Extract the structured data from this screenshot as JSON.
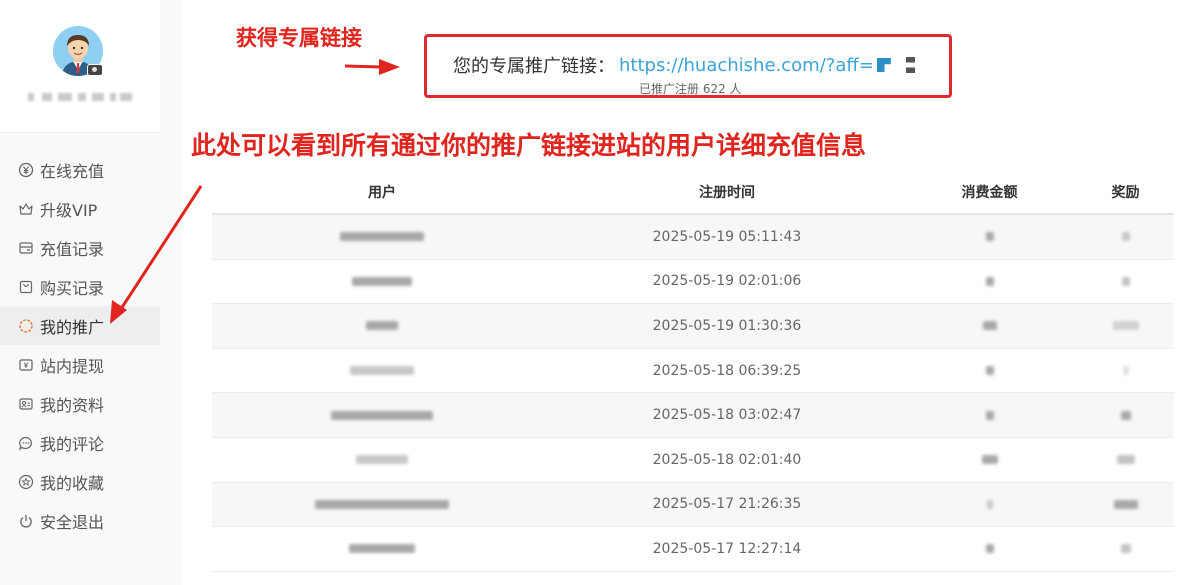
{
  "sidebar": {
    "items": [
      {
        "label": "在线充值",
        "icon": "yen-circle-icon"
      },
      {
        "label": "升级VIP",
        "icon": "crown-icon"
      },
      {
        "label": "充值记录",
        "icon": "wallet-icon"
      },
      {
        "label": "购买记录",
        "icon": "shopping-bag-icon"
      },
      {
        "label": "我的推广",
        "icon": "spinner-icon",
        "active": true
      },
      {
        "label": "站内提现",
        "icon": "withdraw-icon"
      },
      {
        "label": "我的资料",
        "icon": "id-card-icon"
      },
      {
        "label": "我的评论",
        "icon": "comment-icon"
      },
      {
        "label": "我的收藏",
        "icon": "star-circle-icon"
      },
      {
        "label": "安全退出",
        "icon": "power-icon"
      }
    ]
  },
  "promo": {
    "label": "您的专属推广链接：",
    "url": "https://huachishe.com/?aff=",
    "registered": "已推广注册 622 人"
  },
  "annotations": {
    "link_hint": "获得专属链接",
    "table_hint": "此处可以看到所有通过你的推广链接进站的用户详细充值信息",
    "color": "#e0251e"
  },
  "table": {
    "headers": [
      "用户",
      "注册时间",
      "消费金额",
      "奖励"
    ],
    "rows": [
      {
        "time": "2025-05-19 05:11:43"
      },
      {
        "time": "2025-05-19 02:01:06"
      },
      {
        "time": "2025-05-19 01:30:36"
      },
      {
        "time": "2025-05-18 06:39:25"
      },
      {
        "time": "2025-05-18 03:02:47"
      },
      {
        "time": "2025-05-18 02:01:40"
      },
      {
        "time": "2025-05-17 21:26:35"
      },
      {
        "time": "2025-05-17 12:27:14"
      }
    ]
  },
  "colors": {
    "accent": "#e0251e",
    "link": "#3aa3d8",
    "active_icon": "#f07a2d"
  }
}
